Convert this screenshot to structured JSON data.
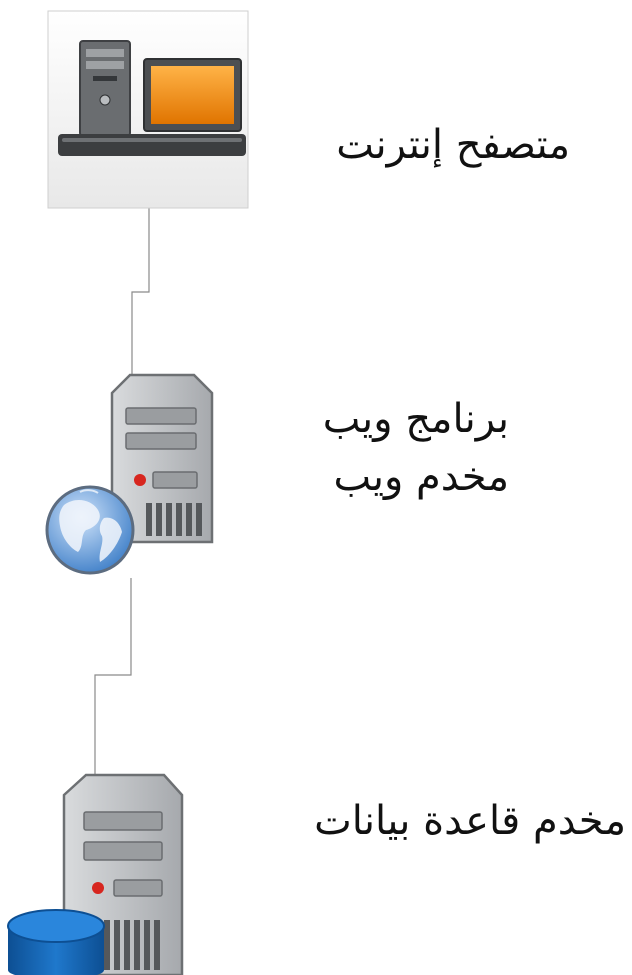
{
  "nodes": {
    "browser": {
      "label": "متصفح إنترنت"
    },
    "web_server": {
      "line1": "برنامج ويب",
      "line2": "مخدم ويب"
    },
    "db_server": {
      "label": "مخدم قاعدة بيانات"
    }
  },
  "colors": {
    "connector": "#8a8a8a",
    "monitor_screen": "#f08a0c",
    "tower_body": "#b9bcbf",
    "globe": "#4f8fd4",
    "database": "#1f74c4"
  },
  "icons": [
    "desktop-computer-icon",
    "web-server-icon",
    "globe-icon",
    "database-server-icon",
    "database-icon"
  ]
}
